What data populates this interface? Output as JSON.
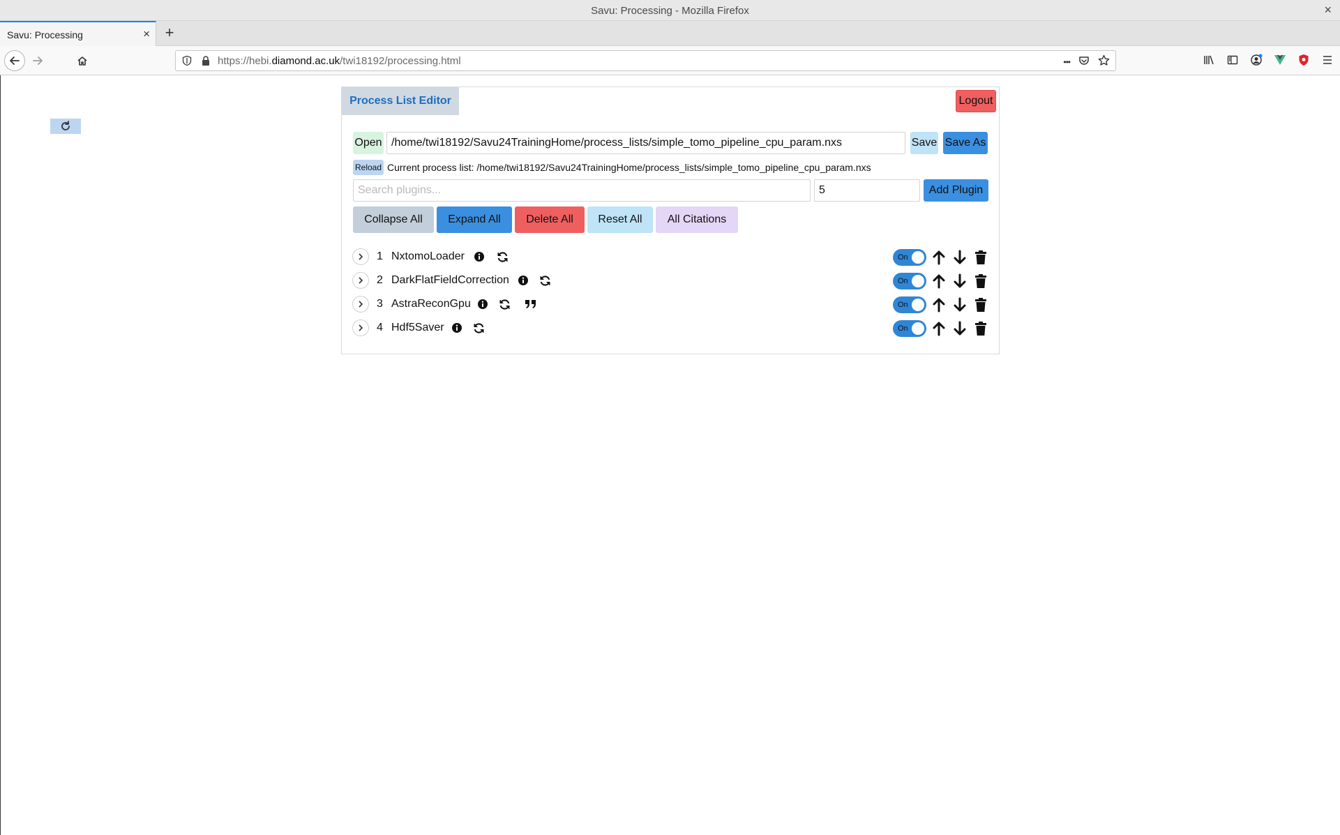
{
  "window": {
    "title": "Savu: Processing - Mozilla Firefox",
    "close_glyph": "×"
  },
  "browser": {
    "tab_title": "Savu: Processing",
    "tab_close_glyph": "×",
    "new_tab_glyph": "+",
    "url_prefix": "https://hebi.",
    "url_domain": "diamond.ac.uk",
    "url_path": "/twi18192/processing.html",
    "page_actions_glyph": "•••"
  },
  "app": {
    "tab_label": "Process List Editor",
    "logout_label": "Logout",
    "open_label": "Open",
    "path_value": "/home/twi18192/Savu24TrainingHome/process_lists/simple_tomo_pipeline_cpu_param.nxs",
    "save_label": "Save",
    "save_as_label": "Save As",
    "reload_label": "Reload",
    "current_list_text": "Current process list: /home/twi18192/Savu24TrainingHome/process_lists/simple_tomo_pipeline_cpu_param.nxs",
    "search_placeholder": "Search plugins...",
    "position_value": "5",
    "add_plugin_label": "Add Plugin",
    "collapse_all_label": "Collapse All",
    "expand_all_label": "Expand All",
    "delete_all_label": "Delete All",
    "reset_all_label": "Reset All",
    "all_citations_label": "All Citations",
    "toggle_label": "On"
  },
  "plugins": [
    {
      "number": "1",
      "name": "NxtomoLoader",
      "has_citation": false,
      "enabled": true
    },
    {
      "number": "2",
      "name": "DarkFlatFieldCorrection",
      "has_citation": false,
      "enabled": true
    },
    {
      "number": "3",
      "name": "AstraReconGpu",
      "has_citation": true,
      "enabled": true
    },
    {
      "number": "4",
      "name": "Hdf5Saver",
      "has_citation": false,
      "enabled": true
    }
  ],
  "colors": {
    "accent_blue": "#3b8fe0",
    "danger_red": "#ef5f60",
    "open_green": "#d8f3df",
    "light_blue": "#bfe3f7",
    "citation_purple": "#e4d6f6"
  }
}
